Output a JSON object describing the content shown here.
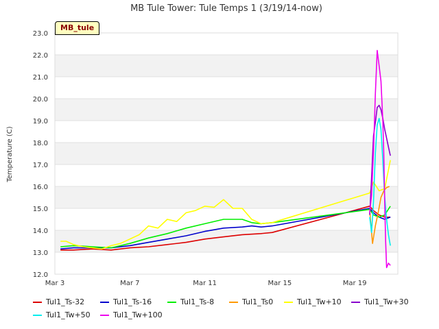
{
  "chart_data": {
    "type": "line",
    "title": "MB Tule Tower: Tule Temps 1 (3/19/14-now)",
    "ylabel": "Temperature (C)",
    "xlabel": "",
    "badge": "MB_tule",
    "ylim": [
      12.0,
      23.0
    ],
    "xlim": [
      3,
      21.3
    ],
    "yticks": [
      "12.0",
      "13.0",
      "14.0",
      "15.0",
      "16.0",
      "17.0",
      "18.0",
      "19.0",
      "20.0",
      "21.0",
      "22.0",
      "23.0"
    ],
    "xticks": [
      {
        "value": 3,
        "label": "Mar 3"
      },
      {
        "value": 7,
        "label": "Mar 7"
      },
      {
        "value": 11,
        "label": "Mar 11"
      },
      {
        "value": 15,
        "label": "Mar 15"
      },
      {
        "value": 19,
        "label": "Mar 19"
      }
    ],
    "grid": true,
    "legend_position": "bottom",
    "series": [
      {
        "name": "Tul1_Ts-32",
        "color": "#dd0000",
        "x": [
          3.3,
          4,
          5,
          6,
          7,
          8,
          9,
          10,
          11,
          12,
          13,
          14,
          14.6,
          19.8,
          20.0,
          20.3,
          20.6,
          20.9
        ],
        "y": [
          13.1,
          13.1,
          13.15,
          13.1,
          13.2,
          13.25,
          13.35,
          13.45,
          13.6,
          13.7,
          13.8,
          13.85,
          13.9,
          15.1,
          14.9,
          14.7,
          14.6,
          14.6
        ]
      },
      {
        "name": "Tul1_Ts-16",
        "color": "#0000cc",
        "x": [
          3.3,
          4,
          5,
          6,
          7,
          8,
          9,
          10,
          11,
          12,
          13,
          13.5,
          14,
          14.6,
          19.8,
          20.0,
          20.3,
          20.6,
          20.9
        ],
        "y": [
          13.15,
          13.2,
          13.2,
          13.2,
          13.3,
          13.45,
          13.6,
          13.75,
          13.95,
          14.1,
          14.15,
          14.2,
          14.15,
          14.2,
          15.0,
          14.8,
          14.6,
          14.5,
          14.6
        ]
      },
      {
        "name": "Tul1_Ts-8",
        "color": "#00ee00",
        "x": [
          3.3,
          4,
          5,
          6,
          7,
          8,
          9,
          10,
          11,
          12,
          13,
          13.5,
          14,
          14.6,
          19.8,
          20.0,
          20.3,
          20.6,
          20.9
        ],
        "y": [
          13.25,
          13.3,
          13.25,
          13.2,
          13.4,
          13.65,
          13.85,
          14.1,
          14.3,
          14.5,
          14.5,
          14.35,
          14.3,
          14.35,
          14.95,
          14.7,
          14.6,
          14.7,
          15.1
        ]
      },
      {
        "name": "Tul1_Ts0",
        "color": "#ff9900",
        "x": [
          19.8,
          19.95,
          20.1,
          20.25,
          20.4,
          20.55,
          20.7,
          20.85
        ],
        "y": [
          14.9,
          13.4,
          14.2,
          14.8,
          15.5,
          15.8,
          15.95,
          16.0
        ]
      },
      {
        "name": "Tul1_Tw+10",
        "color": "#ffff00",
        "x": [
          3.3,
          3.6,
          4,
          4.5,
          5,
          5.5,
          6,
          6.5,
          7,
          7.5,
          8,
          8.5,
          9,
          9.5,
          10,
          10.5,
          11,
          11.5,
          12,
          12.5,
          13,
          13.5,
          14,
          14.6,
          19.8,
          20.0,
          20.3,
          20.6,
          20.9
        ],
        "y": [
          13.5,
          13.5,
          13.35,
          13.25,
          13.2,
          13.15,
          13.3,
          13.4,
          13.6,
          13.8,
          14.2,
          14.1,
          14.5,
          14.4,
          14.8,
          14.9,
          15.1,
          15.05,
          15.4,
          15.0,
          15.0,
          14.5,
          14.3,
          14.35,
          15.7,
          16.2,
          15.8,
          15.9,
          17.2
        ]
      },
      {
        "name": "Tul1_Tw+30",
        "color": "#8800cc",
        "x": [
          19.8,
          19.9,
          20.0,
          20.1,
          20.2,
          20.3,
          20.4,
          20.5,
          20.6,
          20.7,
          20.8,
          20.9
        ],
        "y": [
          14.7,
          16.4,
          18.3,
          18.9,
          19.6,
          19.7,
          19.5,
          19.1,
          18.6,
          18.2,
          17.8,
          17.4
        ]
      },
      {
        "name": "Tul1_Tw+50",
        "color": "#00eeee",
        "x": [
          19.8,
          19.9,
          20.0,
          20.1,
          20.2,
          20.3,
          20.4,
          20.5,
          20.6,
          20.7,
          20.8,
          20.9
        ],
        "y": [
          14.6,
          13.9,
          15.3,
          17.5,
          18.8,
          19.1,
          18.6,
          17.2,
          15.5,
          14.5,
          13.8,
          13.3
        ]
      },
      {
        "name": "Tul1_Tw+100",
        "color": "#ee00ee",
        "x": [
          19.8,
          19.9,
          20.0,
          20.1,
          20.2,
          20.3,
          20.4,
          20.5,
          20.55,
          20.6,
          20.65,
          20.7,
          20.8,
          20.9
        ],
        "y": [
          14.8,
          15.6,
          17.6,
          20.2,
          22.2,
          21.5,
          20.8,
          19.0,
          17.5,
          15.2,
          13.5,
          12.3,
          12.5,
          12.4
        ]
      }
    ]
  }
}
